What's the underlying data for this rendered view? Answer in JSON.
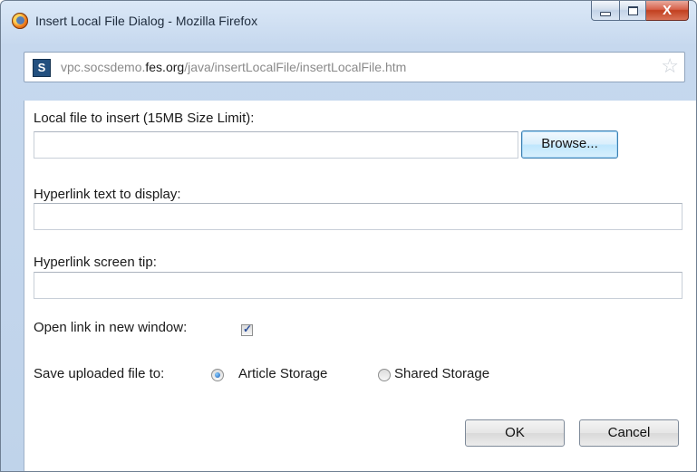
{
  "window": {
    "title": "Insert Local File Dialog - Mozilla Firefox",
    "minimize_label": "",
    "maximize_label": "",
    "close_label": "X"
  },
  "address_bar": {
    "url_prefix": "vpc.socsdemo.",
    "url_domain": "fes.org",
    "url_path": "/java/insertLocalFile/insertLocalFile.htm",
    "site_icon_text": "S",
    "bookmark_icon": "☆"
  },
  "form": {
    "file_label": "Local file to insert (15MB Size Limit):",
    "file_value": "",
    "browse_label": "Browse...",
    "hyperlink_text_label": "Hyperlink text to display:",
    "hyperlink_text_value": "",
    "screen_tip_label": "Hyperlink screen tip:",
    "screen_tip_value": "",
    "new_window_label": "Open link in new window:",
    "new_window_checked": true,
    "save_to_label": "Save uploaded file to:",
    "storage_options": [
      {
        "label": "Article Storage",
        "selected": true
      },
      {
        "label": "Shared Storage",
        "selected": false
      }
    ],
    "ok_label": "OK",
    "cancel_label": "Cancel"
  },
  "icons": {
    "app": "firefox-icon",
    "site": "site-favicon-icon",
    "bookmark": "star-icon",
    "checkmark": "✓"
  }
}
